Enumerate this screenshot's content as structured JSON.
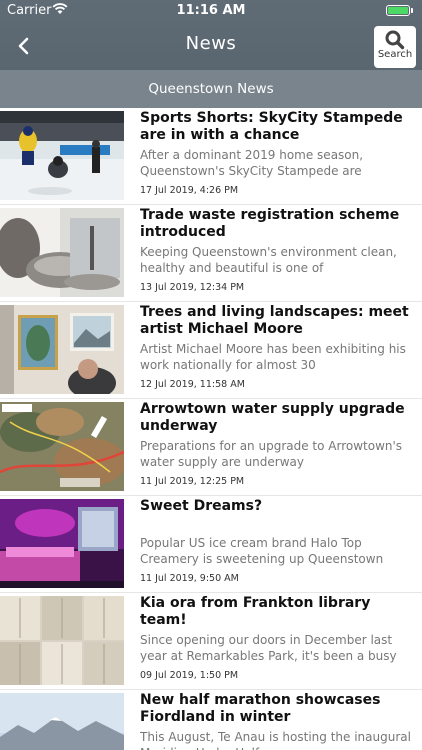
{
  "status_bar": {
    "carrier": "Carrier",
    "time": "11:16 AM",
    "battery_color": "#4cd964"
  },
  "nav": {
    "title": "News",
    "search_label": "Search",
    "back_icon": "chevron-left-icon",
    "search_icon": "magnifier-icon"
  },
  "section": {
    "title": "Queenstown News"
  },
  "articles": [
    {
      "title": "Sports Shorts: SkyCity Stampede are in with a chance",
      "summary": "After a dominant 2019 home season, Queenstown's SkyCity Stampede are",
      "date": "17 Jul 2019, 4:26 PM"
    },
    {
      "title": "Trade waste registration scheme introduced",
      "summary": "Keeping Queenstown's environment clean, healthy and beautiful is one of",
      "date": "13 Jul 2019, 12:34 PM"
    },
    {
      "title": "Trees and living landscapes: meet artist Michael Moore",
      "summary": "Artist Michael Moore has been exhibiting his work nationally for almost 30",
      "date": "12 Jul 2019, 11:58 AM"
    },
    {
      "title": "Arrowtown water supply upgrade underway",
      "summary": "Preparations for an upgrade to Arrowtown's water supply are underway",
      "date": "11 Jul 2019, 12:25 PM"
    },
    {
      "title": "Sweet Dreams?",
      "summary": "Popular US ice cream brand Halo Top Creamery is sweetening up Queenstown",
      "date": "11 Jul 2019, 9:50 AM"
    },
    {
      "title": "Kia ora from Frankton library team!",
      "summary": "Since opening our doors in December last year at Remarkables Park, it's been a busy",
      "date": "09 Jul 2019, 1:50 PM"
    },
    {
      "title": "New half marathon showcases Fiordland in winter",
      "summary": "This August, Te Anau is hosting the inaugural Meridian Hydro Half",
      "date": ""
    }
  ]
}
